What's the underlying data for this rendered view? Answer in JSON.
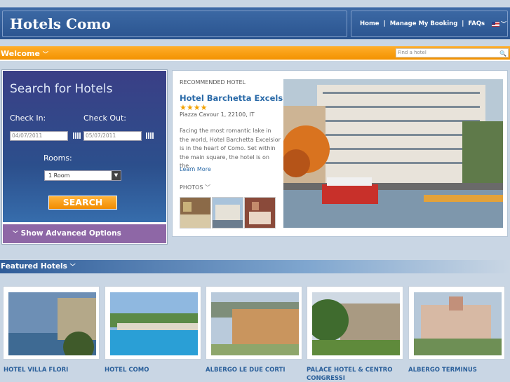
{
  "header": {
    "logo": "Hotels Como",
    "nav": {
      "home": "Home",
      "manage": "Manage My Booking",
      "faqs": "FAQs",
      "sep": "|"
    }
  },
  "welcome": {
    "label": "Welcome",
    "search_placeholder": "Find a hotel"
  },
  "search": {
    "title": "Search for Hotels",
    "check_in_label": "Check In:",
    "check_in_value": "04/07/2011",
    "check_out_label": "Check Out:",
    "check_out_value": "05/07/2011",
    "rooms_label": "Rooms:",
    "rooms_value": "1 Room",
    "search_button": "SEARCH",
    "advanced": "Show Advanced Options"
  },
  "recommended": {
    "heading": "RECOMMENDED HOTEL",
    "name": "Hotel Barchetta Excelsior",
    "stars": "★★★★",
    "address": "Piazza Cavour 1, 22100, IT",
    "description": "Facing the most romantic lake in the world, Hotel Barchetta Excelsior is in the heart of Como. Set within the main square, the hotel is on the...",
    "learn_more": "Learn More",
    "photos_label": "PHOTOS"
  },
  "featured": {
    "label": "Featured Hotels",
    "hotels": [
      {
        "name": "HOTEL VILLA FLORI"
      },
      {
        "name": "HOTEL COMO"
      },
      {
        "name": "ALBERGO LE DUE CORTI"
      },
      {
        "name": "PALACE HOTEL & CENTRO CONGRESSI"
      },
      {
        "name": "ALBERGO TERMINUS"
      }
    ]
  },
  "colors": {
    "accent_orange": "#f39200",
    "header_blue": "#2a548f",
    "link_blue": "#2a6aa8",
    "purple": "#8e67a6"
  }
}
